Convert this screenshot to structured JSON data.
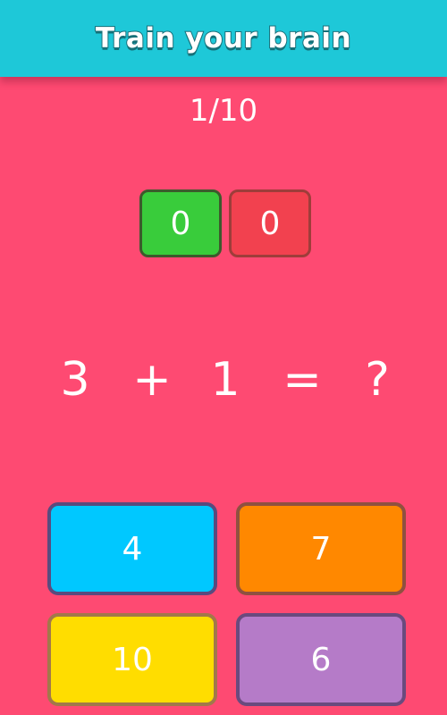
{
  "header": {
    "title": "Train your brain"
  },
  "progress": "1/10",
  "scores": {
    "correct": "0",
    "wrong": "0"
  },
  "question": {
    "left": "3",
    "operator": "+",
    "right": "1",
    "equals": "=",
    "unknown": "?"
  },
  "answers": [
    "4",
    "7",
    "10",
    "6"
  ],
  "colors": {
    "background": "#fe4a72",
    "header": "#1ec8d8",
    "correct": "#39cc3b",
    "wrong": "#f2414f",
    "answer_1": "#00c8ff",
    "answer_2": "#ff8800",
    "answer_3": "#ffdd00",
    "answer_4": "#b57bc8"
  }
}
